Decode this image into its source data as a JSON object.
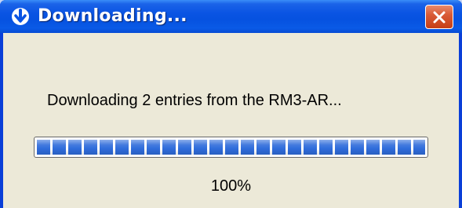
{
  "window": {
    "title": "Downloading...",
    "title_icon": "down-arrow-icon",
    "close_icon": "close-icon"
  },
  "message": "Downloading 2 entries from the RM3-AR...",
  "progress": {
    "fraction": 1.0,
    "label": "100%"
  },
  "colors": {
    "titlebar": "#0a54e3",
    "client_background": "#ece9d8",
    "progress_block": "#2f6cdb",
    "close_button": "#d95b37"
  }
}
